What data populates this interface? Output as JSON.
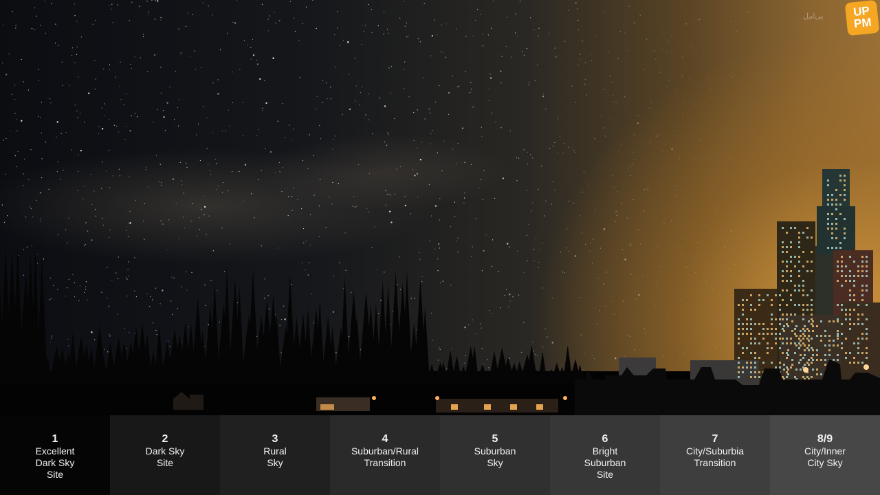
{
  "scale": [
    {
      "number": "1",
      "label": "Excellent\nDark Sky\nSite",
      "bg": "#050505"
    },
    {
      "number": "2",
      "label": "Dark Sky\nSite",
      "bg": "#181818"
    },
    {
      "number": "3",
      "label": "Rural\nSky",
      "bg": "#202020"
    },
    {
      "number": "4",
      "label": "Suburban/Rural\nTransition",
      "bg": "#2a2a2a"
    },
    {
      "number": "5",
      "label": "Suburban\nSky",
      "bg": "#303030"
    },
    {
      "number": "6",
      "label": "Bright\nSuburban\nSite",
      "bg": "#373737"
    },
    {
      "number": "7",
      "label": "City/Suburbia\nTransition",
      "bg": "#3e3e3e"
    },
    {
      "number": "8/9",
      "label": "City/Inner\nCity Sky",
      "bg": "#474747"
    }
  ],
  "logo": {
    "text": "UP\nPM",
    "color": "#f5a623"
  },
  "watermark": "یی‌امل"
}
